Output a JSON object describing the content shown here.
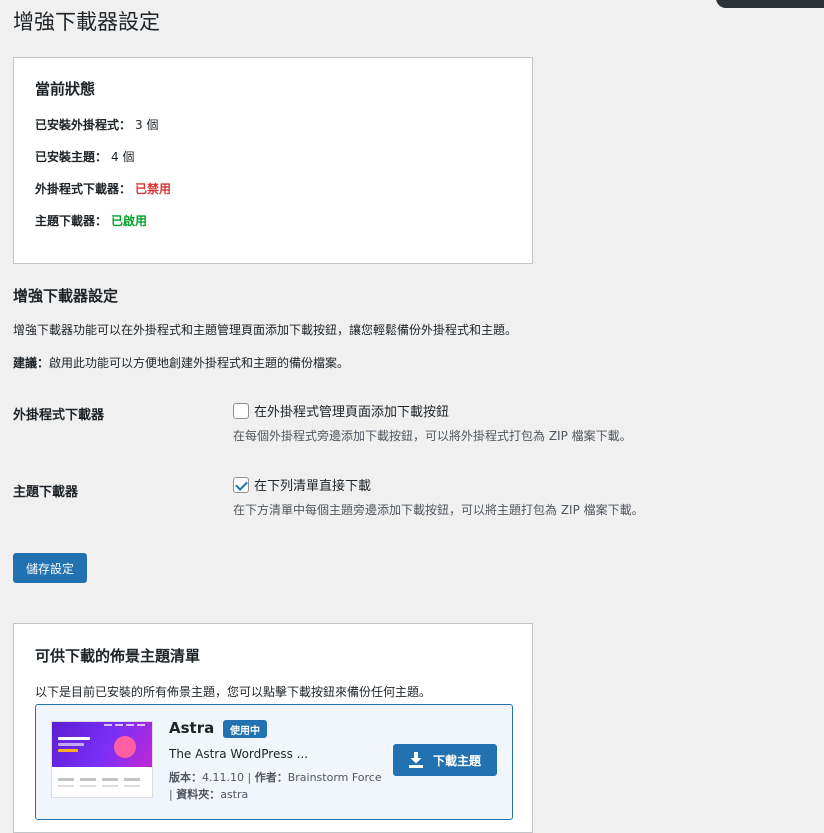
{
  "page": {
    "title": "增強下載器設定"
  },
  "status": {
    "heading": "當前狀態",
    "rows": [
      {
        "label": "已安裝外掛程式：",
        "value": "3 個"
      },
      {
        "label": "已安裝主題：",
        "value": "4 個"
      },
      {
        "label": "外掛程式下載器：",
        "value": "已禁用"
      },
      {
        "label": "主題下載器：",
        "value": "已啟用"
      }
    ],
    "colors": {
      "disabled": "#d63638",
      "enabled": "#00a32a"
    }
  },
  "settings": {
    "heading": "增強下載器設定",
    "description": "增強下載器功能可以在外掛程式和主題管理頁面添加下載按鈕，讓您輕鬆備份外掛程式和主題。",
    "tip_label": "建議：",
    "tip_text": "啟用此功能可以方便地創建外掛程式和主題的備份檔案。",
    "fields": [
      {
        "label": "外掛程式下載器",
        "checkbox_label": "在外掛程式管理頁面添加下載按鈕",
        "checked": false,
        "description": "在每個外掛程式旁邊添加下載按鈕，可以將外掛程式打包為 ZIP 檔案下載。"
      },
      {
        "label": "主題下載器",
        "checkbox_label": "在下列清單直接下載",
        "checked": true,
        "description": "在下方清單中每個主題旁邊添加下載按鈕，可以將主題打包為 ZIP 檔案下載。"
      }
    ],
    "save_label": "儲存設定"
  },
  "themes": {
    "heading": "可供下載的佈景主題清單",
    "intro": "以下是目前已安裝的所有佈景主題，您可以點擊下載按鈕來備份任何主題。",
    "items": [
      {
        "name": "Astra",
        "badge": "使用中",
        "description": "The Astra WordPress ...",
        "version_label": "版本：",
        "version": "4.11.10",
        "author_label": "作者：",
        "author": "Brainstorm Force",
        "folder_label": "資料夾：",
        "folder": "astra",
        "download_label": "下載主題",
        "icon": "download-icon"
      }
    ]
  },
  "accent": "#2271b1"
}
